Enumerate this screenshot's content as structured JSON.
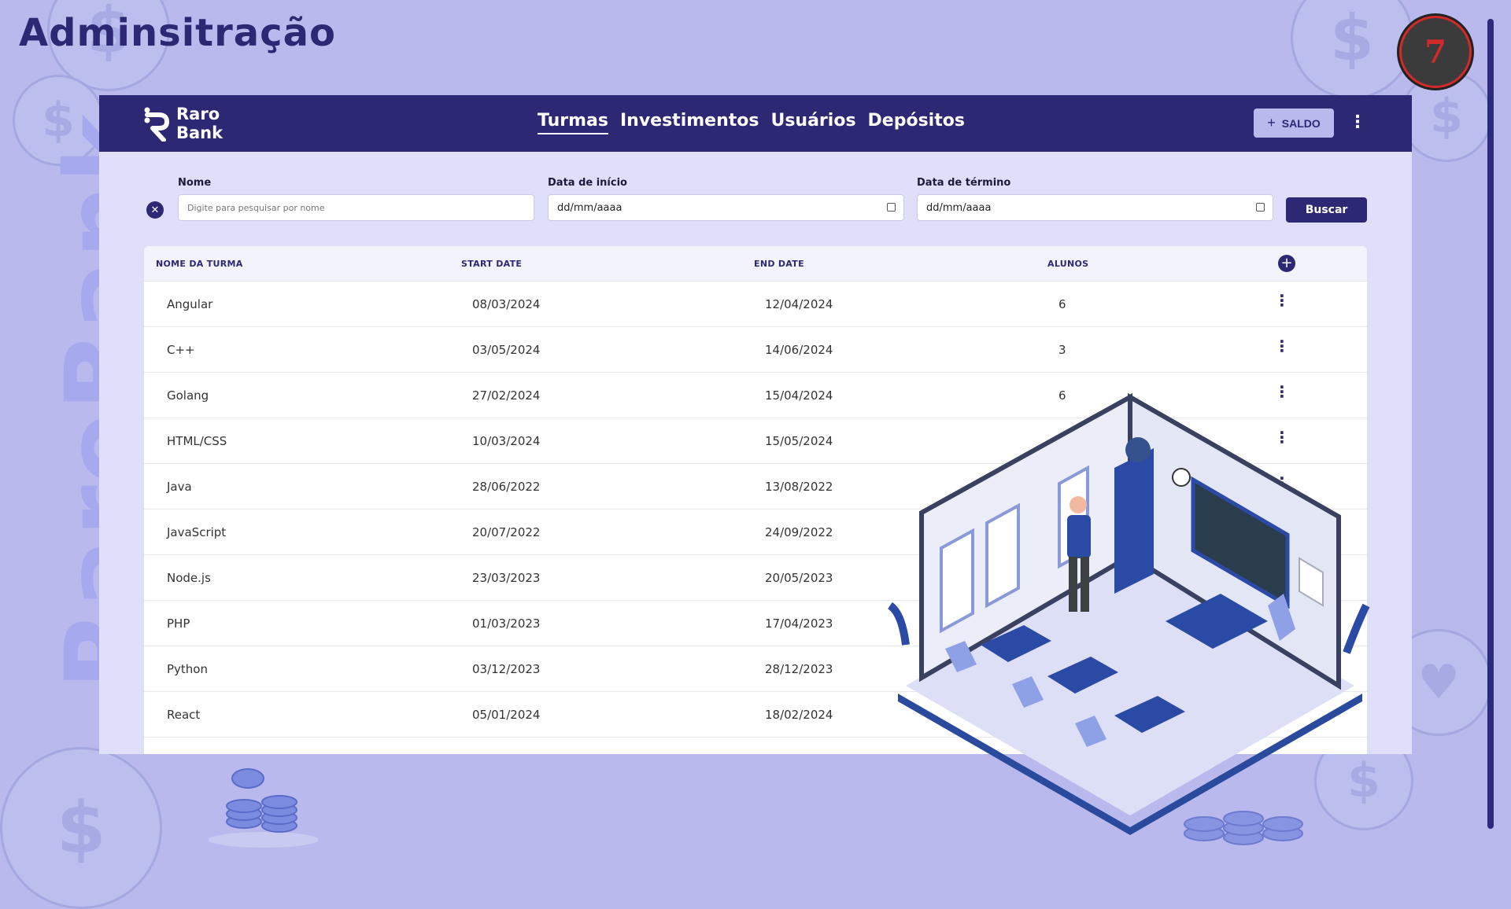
{
  "slide": {
    "title": "Adminsitração",
    "watermark": "RaroBank"
  },
  "app": {
    "brand": {
      "line1": "Raro",
      "line2": "Bank"
    },
    "nav": [
      {
        "label": "Turmas",
        "active": true
      },
      {
        "label": "Investimentos",
        "active": false
      },
      {
        "label": "Usuários",
        "active": false
      },
      {
        "label": "Depósitos",
        "active": false
      }
    ],
    "saldo_label": "SALDO",
    "filters": {
      "nome_label": "Nome",
      "nome_placeholder": "Digite para pesquisar por nome",
      "inicio_label": "Data de início",
      "inicio_value": "dd/mm/aaaa",
      "termino_label": "Data de término",
      "termino_value": "dd/mm/aaaa",
      "buscar_label": "Buscar"
    },
    "table": {
      "headers": [
        "NOME DA TURMA",
        "START DATE",
        "END DATE",
        "ALUNOS"
      ],
      "rows": [
        {
          "nome": "Angular",
          "start": "08/03/2024",
          "end": "12/04/2024",
          "alunos": "6"
        },
        {
          "nome": "C++",
          "start": "03/05/2024",
          "end": "14/06/2024",
          "alunos": "3"
        },
        {
          "nome": "Golang",
          "start": "27/02/2024",
          "end": "15/04/2024",
          "alunos": "6"
        },
        {
          "nome": "HTML/CSS",
          "start": "10/03/2024",
          "end": "15/05/2024",
          "alunos": ""
        },
        {
          "nome": "Java",
          "start": "28/06/2022",
          "end": "13/08/2022",
          "alunos": ""
        },
        {
          "nome": "JavaScript",
          "start": "20/07/2022",
          "end": "24/09/2022",
          "alunos": ""
        },
        {
          "nome": "Node.js",
          "start": "23/03/2023",
          "end": "20/05/2023",
          "alunos": ""
        },
        {
          "nome": "PHP",
          "start": "01/03/2023",
          "end": "17/04/2023",
          "alunos": ""
        },
        {
          "nome": "Python",
          "start": "03/12/2023",
          "end": "28/12/2023",
          "alunos": ""
        },
        {
          "nome": "React",
          "start": "05/01/2024",
          "end": "18/02/2024",
          "alunos": ""
        }
      ]
    }
  },
  "colors": {
    "background": "#b9b9ed",
    "primary": "#2c2874",
    "app_bg": "#dfdffa",
    "badge_red": "#d12a2a"
  },
  "icons": [
    "close-icon",
    "plus-icon",
    "kebab-menu-icon",
    "calendar-icon",
    "coin-icon",
    "logo-badge-icon"
  ]
}
